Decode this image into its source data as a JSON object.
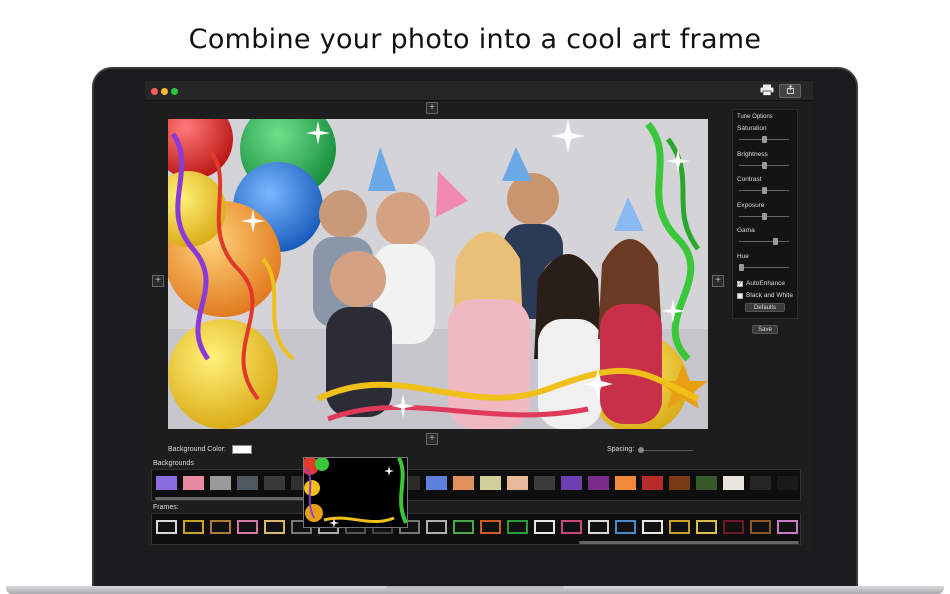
{
  "headline": "Combine your photo into a cool art frame",
  "window": {
    "traffic_lights": {
      "close": "#ff5f57",
      "minimize": "#febc2e",
      "zoom": "#28c840"
    },
    "print_icon": "printer-icon",
    "share_icon": "share-icon"
  },
  "canvas": {
    "add_symbol": "+"
  },
  "tune_options": {
    "title": "Tune Options",
    "sliders": [
      {
        "label": "Saturation",
        "value": 0.5
      },
      {
        "label": "Brightness",
        "value": 0.5
      },
      {
        "label": "Contrast",
        "value": 0.5
      },
      {
        "label": "Exposure",
        "value": 0.5
      },
      {
        "label": "Gama",
        "value": 0.75
      },
      {
        "label": "Hue",
        "value": 0.0
      }
    ],
    "auto_enhance": {
      "label": "AutoEnhance",
      "checked": true
    },
    "black_and_white": {
      "label": "Black and White",
      "checked": false
    },
    "defaults_label": "Defaults",
    "save_label": "Save"
  },
  "controls": {
    "background_color_label": "Background Color:",
    "background_color": "#ffffff",
    "spacing_label": "Spacing:",
    "spacing_value": 0.0
  },
  "backgrounds": {
    "label": "Backgrounds",
    "swatches": [
      "#8a6be0",
      "#e88aa0",
      "#9a9a9a",
      "#505862",
      "#3a3a3a",
      "#2f2f2f",
      "#1c1c1c",
      "#262626",
      "#333",
      "#2b2b2b",
      "#5e7fdc",
      "#e0905a",
      "#cfcf9a",
      "#e8b89a",
      "#3b3b3b",
      "#6b3fb0",
      "#7a2c8c",
      "#f08a3a",
      "#b82b2b",
      "#7a3a18",
      "#355a28",
      "#e9e5dc",
      "#262626",
      "#1a1a1a"
    ]
  },
  "frames": {
    "label": "Frames:",
    "borders": [
      "#d8d8d8",
      "#c9a227",
      "#b07a3a",
      "#d07aa0",
      "#d8b86a",
      "#777",
      "#aaa",
      "#555",
      "#444",
      "#777",
      "#b0b0b0",
      "#4aa84a",
      "#d05a2a",
      "#2a9a3a",
      "#e6e6e6",
      "#c84a7a",
      "#d8d8d8",
      "#4a8ac8",
      "#e6e6e6",
      "#c9a227",
      "#d8c04a",
      "#6a1a2a",
      "#8a5a2a",
      "#c87ac8"
    ]
  }
}
